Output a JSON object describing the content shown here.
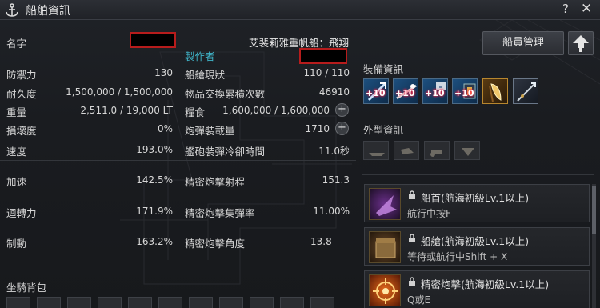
{
  "window": {
    "title": "船舶資訊",
    "help": "?",
    "close": "✕"
  },
  "ship": {
    "name_label": "名字",
    "type_name": "艾裴莉雅重帆船：飛翔",
    "maker_label": "製作者"
  },
  "stats_left": [
    {
      "label": "防禦力",
      "value": "130"
    },
    {
      "label": "耐久度",
      "value": "1,500,000 / 1,500,000"
    },
    {
      "label": "重量",
      "value": "2,511.0 / 19,000 LT"
    },
    {
      "label": "損壞度",
      "value": "0%"
    },
    {
      "label": "速度",
      "value": "193.0%"
    },
    {
      "label": "加速",
      "value": "142.5%"
    },
    {
      "label": "迴轉力",
      "value": "171.9%"
    },
    {
      "label": "制動",
      "value": "163.2%"
    }
  ],
  "stats_right": [
    {
      "label": "船艙現狀",
      "value": "110 / 110"
    },
    {
      "label": "物品交換累積次數",
      "value": "46910"
    },
    {
      "label": "糧食",
      "value": "1,600,000 / 1,600,000"
    },
    {
      "label": "炮彈裝載量",
      "value": "1710"
    },
    {
      "label": "艦砲裝彈冷卻時間",
      "value": "11.0秒"
    },
    {
      "label": "精密炮擊射程",
      "value": "151.3"
    },
    {
      "label": "精密炮擊集彈率",
      "value": "11.00%"
    },
    {
      "label": "精密炮擊角度",
      "value": "13.8"
    }
  ],
  "plus_symbol": "+",
  "mount_bag_label": "坐騎背包",
  "crew_button": "船員管理",
  "equipment": {
    "title": "裝備資訊",
    "badges": [
      "+10",
      "+10",
      "+10",
      "+10"
    ]
  },
  "appearance": {
    "title": "外型資訊"
  },
  "skills": [
    {
      "name": "船首(航海初級Lv.1以上)",
      "desc": "航行中按F"
    },
    {
      "name": "船艙(航海初級Lv.1以上)",
      "desc": "等待或航行中Shift + X"
    },
    {
      "name": "精密炮擊(航海初級Lv.1以上)",
      "desc": "Q或E"
    }
  ],
  "colors": {
    "maker": "#3fb3c7",
    "redact_border": "#b71c1c",
    "badge_glow": "#ff2244"
  }
}
